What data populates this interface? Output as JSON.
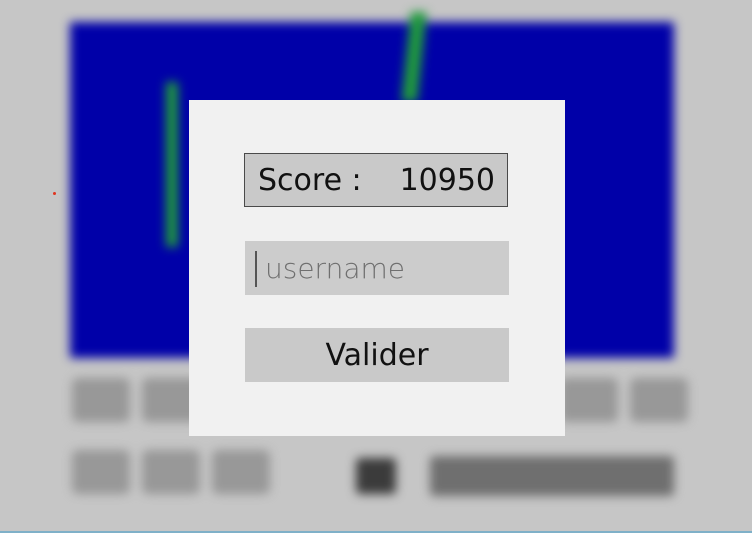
{
  "dialog": {
    "score_label": "Score :",
    "score_value": "10950",
    "username_placeholder": "username",
    "submit_label": "Valider"
  },
  "colors": {
    "playfield": "#0000a8",
    "beam": "#1f9a3c",
    "dialog_background": "#f1f1f1",
    "field_background": "#c9c9c9"
  }
}
